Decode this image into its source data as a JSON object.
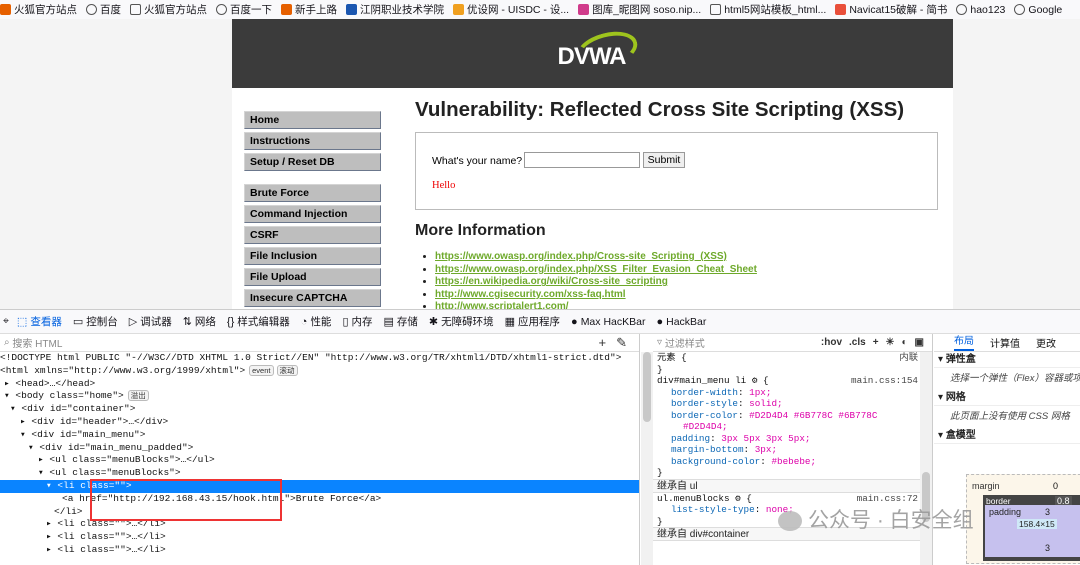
{
  "bookmarks": [
    {
      "icon": "firefox-icon",
      "label": "火狐官方站点",
      "color": "#e66000"
    },
    {
      "icon": "globe-icon",
      "label": "百度",
      "color": "#555555"
    },
    {
      "icon": "folder-icon",
      "label": "火狐官方站点",
      "color": "#555555"
    },
    {
      "icon": "globe-icon",
      "label": "百度一下",
      "color": "#555555"
    },
    {
      "icon": "firefox-icon",
      "label": "新手上路",
      "color": "#e66000"
    },
    {
      "icon": "jp-icon",
      "label": "江阴职业技术学院",
      "color": "#1a56b0"
    },
    {
      "icon": "emoji-icon",
      "label": "优设网 - UISDC - 设...",
      "color": "#f0a020"
    },
    {
      "icon": "image-icon",
      "label": "图库_昵图网 soso.nip...",
      "color": "#d03b8b"
    },
    {
      "icon": "page-icon",
      "label": "html5网站模板_html...",
      "color": "#555555"
    },
    {
      "icon": "jianshu-icon",
      "label": "Navicat15破解 - 简书",
      "color": "#e94f3a"
    },
    {
      "icon": "globe-icon",
      "label": "hao123",
      "color": "#555555"
    },
    {
      "icon": "globe-icon",
      "label": "Google",
      "color": "#555555"
    }
  ],
  "dvwa": {
    "logo_text": "DVWA",
    "menu_group1": [
      "Home",
      "Instructions",
      "Setup / Reset DB"
    ],
    "menu_group2": [
      "Brute Force",
      "Command Injection",
      "CSRF",
      "File Inclusion",
      "File Upload",
      "Insecure CAPTCHA"
    ],
    "title": "Vulnerability: Reflected Cross Site Scripting (XSS)",
    "prompt": "What's your name?",
    "input_value": "",
    "submit_label": "Submit",
    "output": "Hello",
    "more_info_heading": "More Information",
    "links": [
      "https://www.owasp.org/index.php/Cross-site_Scripting_(XSS)",
      "https://www.owasp.org/index.php/XSS_Filter_Evasion_Cheat_Sheet",
      "https://en.wikipedia.org/wiki/Cross-site_scripting",
      "http://www.cgisecurity.com/xss-faq.html",
      "http://www.scriptalert1.com/"
    ]
  },
  "devtools": {
    "tabs": [
      {
        "icon": "inspector-icon",
        "label": "查看器",
        "selected": true
      },
      {
        "icon": "console-icon",
        "label": "控制台"
      },
      {
        "icon": "debugger-icon",
        "label": "调试器"
      },
      {
        "icon": "network-icon",
        "label": "网络"
      },
      {
        "icon": "style-editor-icon",
        "label": "样式编辑器"
      },
      {
        "icon": "performance-icon",
        "label": "性能"
      },
      {
        "icon": "memory-icon",
        "label": "内存"
      },
      {
        "icon": "storage-icon",
        "label": "存储"
      },
      {
        "icon": "accessibility-icon",
        "label": "无障碍环境"
      },
      {
        "icon": "application-icon",
        "label": "应用程序"
      },
      {
        "icon": "hackbar-icon",
        "label": "Max HacKBar"
      },
      {
        "icon": "hackbar-icon",
        "label": "HackBar"
      }
    ],
    "search_placeholder": "搜索 HTML",
    "html_lines": [
      {
        "text": "<!DOCTYPE html PUBLIC \"-//W3C//DTD XHTML 1.0 Strict//EN\" \"http://www.w3.org/TR/xhtml1/DTD/xhtml1-strict.dtd\">"
      },
      {
        "text": "<html xmlns=\"http://www.w3.org/1999/xhtml\">",
        "badge": "event",
        "badge2": "滚动"
      },
      {
        "text": "<head>…</head>"
      },
      {
        "text": "<body class=\"home\">",
        "badge": "溢出"
      },
      {
        "text": "<div id=\"container\">"
      },
      {
        "text": "<div id=\"header\">…</div>"
      },
      {
        "text": "<div id=\"main_menu\">"
      },
      {
        "text": "<div id=\"main_menu_padded\">"
      },
      {
        "text": "<ul class=\"menuBlocks\">…</ul>"
      },
      {
        "text": "<ul class=\"menuBlocks\">"
      },
      {
        "text": "<li class=\"\">",
        "selected": true
      },
      {
        "text": "<a href=\"http://192.168.43.15/hook.html\">Brute Force</a>"
      },
      {
        "text": "</li>"
      },
      {
        "text": "<li class=\"\">…</li>"
      },
      {
        "text": "<li class=\"\">…</li>"
      },
      {
        "text": "<li class=\"\">…</li>"
      }
    ],
    "rules": {
      "filter_placeholder": "过滤样式",
      "pseudo": ":hov",
      "cls": ".cls",
      "element_label": "元素 {",
      "element_src": "内联",
      "rule1_selector": "div#main_menu li",
      "rule1_src": "main.css:154",
      "rule1_props": [
        {
          "p": "border-width",
          "v": "1px;"
        },
        {
          "p": "border-style",
          "v": "solid;"
        },
        {
          "p": "border-color",
          "v": "#D2D4D4  #6B778C  #6B778C"
        },
        {
          "p": "",
          "v": "#D2D4D4;"
        },
        {
          "p": "padding",
          "v": "3px 5px 3px 5px;"
        },
        {
          "p": "margin-bottom",
          "v": "3px;"
        },
        {
          "p": "background-color",
          "v": "#bebebe;"
        }
      ],
      "inherit1": "继承自 ul",
      "rule2_selector": "ul.menuBlocks",
      "rule2_src": "main.css:72",
      "rule2_prop": "list-style-type",
      "rule2_val": "none;",
      "inherit2": "继承自 div#container"
    },
    "layout": {
      "tabs": [
        "布局",
        "计算值",
        "更改"
      ],
      "flex_heading": "弹性盒",
      "flex_hint": "选择一个弹性（Flex）容器或项",
      "grid_heading": "网格",
      "grid_hint": "此页面上没有使用 CSS 网格",
      "boxmodel_heading": "盒模型",
      "margin_label": "margin",
      "border_label": "border",
      "padding_label": "padding",
      "margin_top": "0",
      "border_top": "0.8",
      "padding_top": "3",
      "padding_bottom": "3",
      "content": "158.4×15"
    }
  },
  "watermark": "公众号 · 白安全组"
}
